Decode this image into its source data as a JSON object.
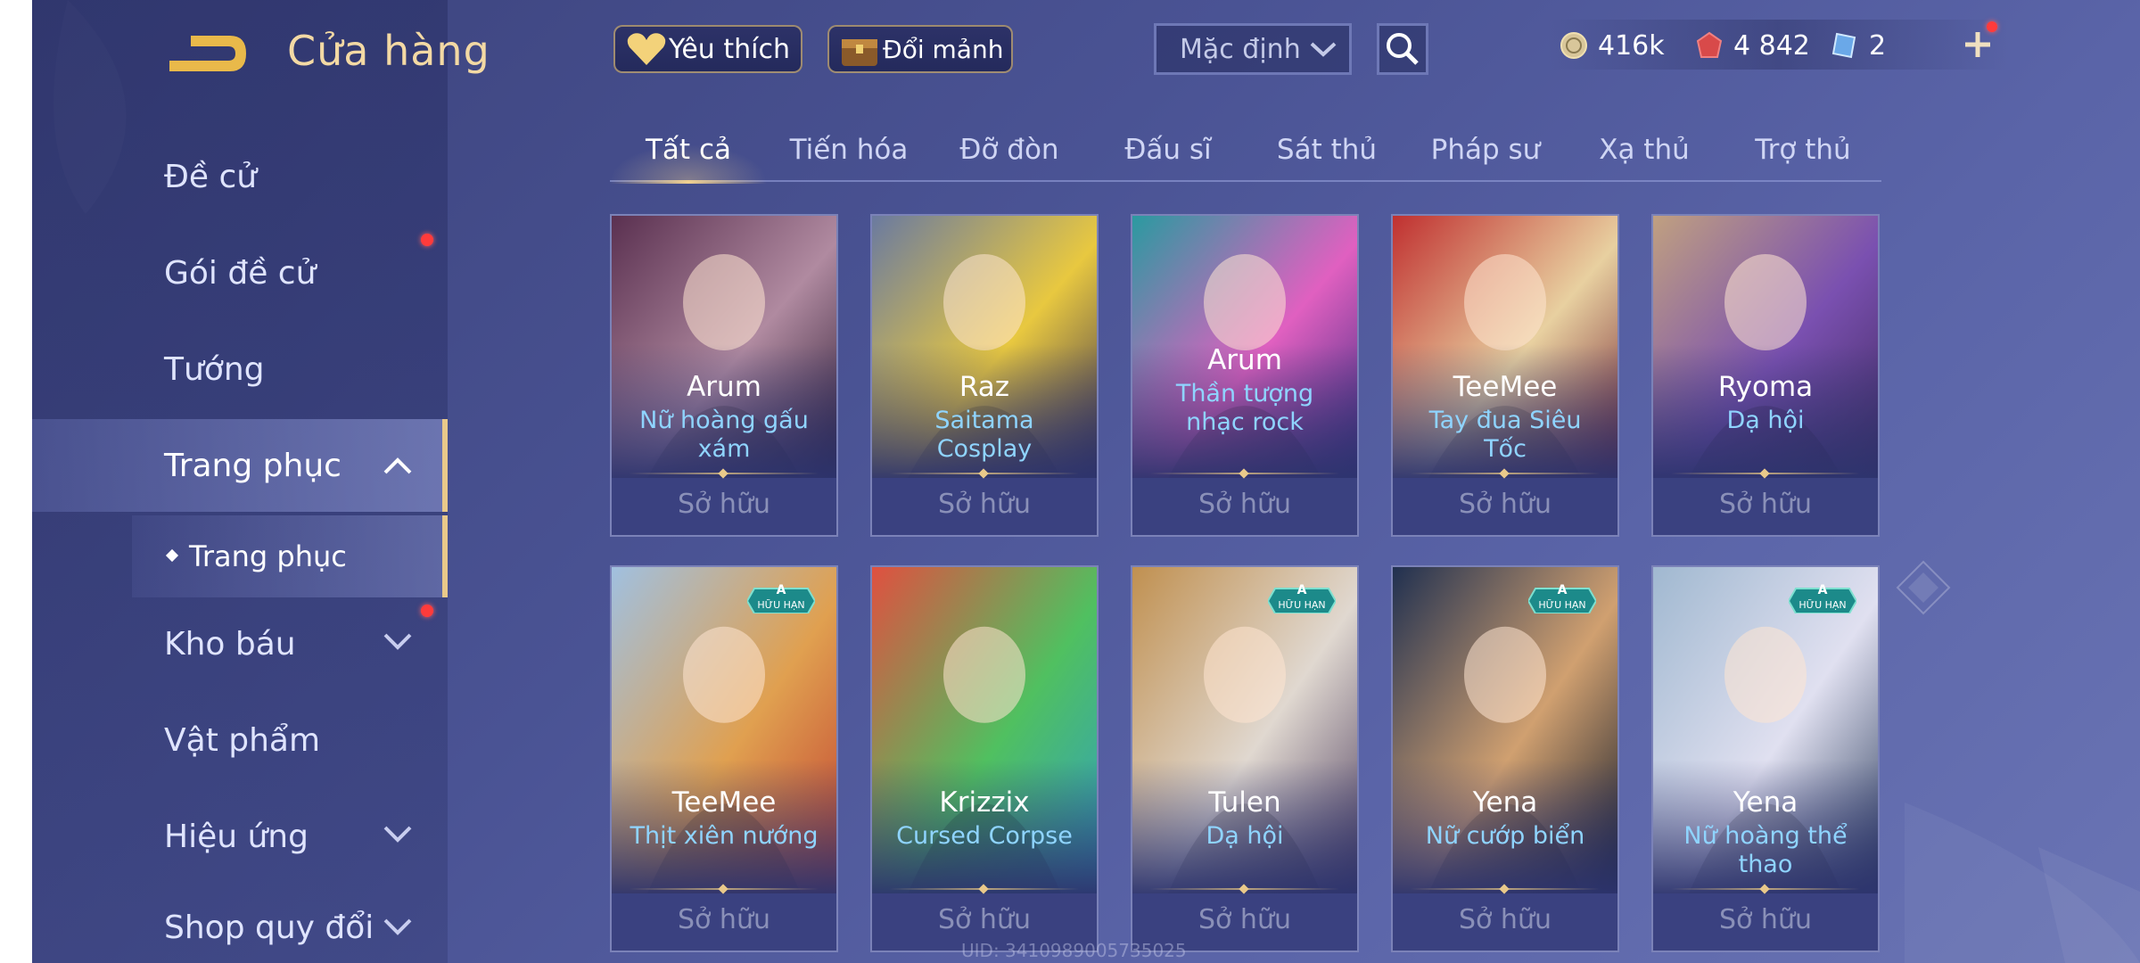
{
  "header": {
    "title": "Cửa hàng",
    "favorite_label": "Yêu thích",
    "exchange_label": "Đổi mảnh",
    "sort": {
      "selected": "Mặc định"
    },
    "currencies": [
      {
        "icon": "gold-coin-icon",
        "value": "416k"
      },
      {
        "icon": "ruby-icon",
        "value": "4 842"
      },
      {
        "icon": "voucher-icon",
        "value": "2"
      }
    ]
  },
  "sidebar": {
    "items": [
      {
        "label": "Đề cử"
      },
      {
        "label": "Gói đề cử"
      },
      {
        "label": "Tướng"
      },
      {
        "label": "Trang phục"
      },
      {
        "label": "Kho báu"
      },
      {
        "label": "Vật phẩm"
      },
      {
        "label": "Hiệu ứng"
      },
      {
        "label": "Shop quy đổi"
      }
    ],
    "sub_item": {
      "label": "Trang phục"
    }
  },
  "tabs": [
    "Tất cả",
    "Tiến hóa",
    "Đỡ đòn",
    "Đấu sĩ",
    "Sát thủ",
    "Pháp sư",
    "Xạ thủ",
    "Trợ thủ"
  ],
  "cards": [
    {
      "hero": "Arum",
      "skin": "Nữ hoàng gấu xám",
      "status": "Sở hữu",
      "badge": null,
      "colors": [
        "#5a3050",
        "#b08aa0",
        "#2a1830"
      ]
    },
    {
      "hero": "Raz",
      "skin": "Saitama Cosplay",
      "status": "Sở hữu",
      "badge": null,
      "colors": [
        "#6a7aa0",
        "#e8c840",
        "#3a3050"
      ]
    },
    {
      "hero": "Arum",
      "skin": "Thần tượng nhạc rock",
      "status": "Sở hữu",
      "badge": null,
      "colors": [
        "#2a9aa0",
        "#e060c0",
        "#3a2a80"
      ]
    },
    {
      "hero": "TeeMee",
      "skin": "Tay đua Siêu Tốc",
      "status": "Sở hữu",
      "badge": null,
      "colors": [
        "#c03030",
        "#e8d0a0",
        "#702030"
      ]
    },
    {
      "hero": "Ryoma",
      "skin": "Dạ hội",
      "status": "Sở hữu",
      "badge": null,
      "colors": [
        "#c0a080",
        "#7a50b0",
        "#402a60"
      ]
    },
    {
      "hero": "TeeMee",
      "skin": "Thịt xiên nướng",
      "status": "Sở hữu",
      "badge": {
        "grade": "A",
        "text": "HỮU HẠN"
      },
      "colors": [
        "#a0c0e0",
        "#e0a050",
        "#c04030"
      ]
    },
    {
      "hero": "Krizzix",
      "skin": "Cursed Corpse",
      "status": "Sở hữu",
      "badge": null,
      "colors": [
        "#e05040",
        "#50c060",
        "#30a0c0"
      ]
    },
    {
      "hero": "Tulen",
      "skin": "Dạ hội",
      "status": "Sở hữu",
      "badge": {
        "grade": "A",
        "text": "HỮU HẠN"
      },
      "colors": [
        "#c09050",
        "#e0d8d0",
        "#504060"
      ]
    },
    {
      "hero": "Yena",
      "skin": "Nữ cướp biển",
      "status": "Sở hữu",
      "badge": {
        "grade": "A",
        "text": "HỮU HẠN"
      },
      "colors": [
        "#203050",
        "#d0a070",
        "#101828"
      ]
    },
    {
      "hero": "Yena",
      "skin": "Nữ hoàng thể thao",
      "status": "Sở hữu",
      "badge": {
        "grade": "A",
        "text": "HỮU HẠN"
      },
      "colors": [
        "#a0b8d0",
        "#e0e0f0",
        "#304060"
      ]
    }
  ],
  "uid_text": "UID: 3410989005735025",
  "theme": {
    "accent": "#e9c98a",
    "skin_text": "#8fd4ff",
    "notify": "#ff3b3b"
  }
}
